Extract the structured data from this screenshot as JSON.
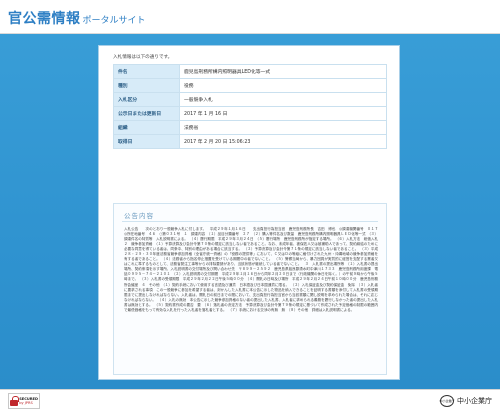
{
  "header": {
    "logo_main": "官公需情報",
    "logo_sub": "ポータルサイト"
  },
  "notice": "入札情報は以下の通りです。",
  "info_rows": [
    {
      "label": "件名",
      "value": "鹿児島刑務所構内照明器具LED化等一式"
    },
    {
      "label": "種別",
      "value": "役務"
    },
    {
      "label": "入札区分",
      "value": "一般競争入札"
    },
    {
      "label": "公示日または更新日",
      "value": "2017 年 1 月 16 日"
    },
    {
      "label": "組織",
      "value": "法務省"
    },
    {
      "label": "取得日",
      "value": "2017 年 2 月 20 日 15:06:23"
    }
  ],
  "content": {
    "title": "公告内容",
    "body": "入札公告　　次のとおり一般競争入札に付します。　平成２９年１月１６日　　支出負担行為担当官　鹿児島刑務所長　吉田　博也　◎調達機関番号　０１７　◎所在地番号　４６　○第０３１号　１　調達内容　（１）品目分類番号　２７　（２）購入等件名及び数量　鹿児島刑務所構内照明器具ＬＥＤ化等一式　（３）調達件名の特質等　入札説明書による。　（４）履行期限　平成２９年３月２４日　（５）履行場所　鹿児島刑務所が指定する場所。　（６）入札方法　総価入札　２　競争参加資格　（１）予算決算及び会計令第７０条の規定に該当しない者であること。なお、未成年者、被保佐人又は被補助人であって、契約締結のために必要な同意を得ている者は、同条中、特別の理由がある場合に該当する。　（２）予算決算及び会計令第７１条の規定に該当しない者であること。　（３）平成２８・２９・３０年度法務省競争参加資格（全省庁統一資格）の「役務の提供等」において、Ｃ又はＤの等級に格付けされた九州・沖縄地域の競争参加資格を有する者であること。　（４）法務省から指名停止措置を受けている期間中の者でないこと。　（５）警察当局から、暴力団員が実質的に経営を支配する業者又はこれに準ずるものとして、法務省発注工事等からの排除要請があり、当該状態が継続している者でないこと。　３　入札書の提出場所等　（１）入札書の提出場所、契約条項を示す場所、入札説明書の交付場所及び問い合わせ先　〒８９９－２５９２　鹿児島県姶良郡湧水町中津川１７３３　鹿児島刑務所用度課　電話０９９５－７４－２１０１　（２）入札説明書の交付期間　平成２９年１月１６日から同年２月２０日まで（行政機関の休日を除く。）の午前９時から午後５時まで。　（３）入札書の受領期限　平成２９年２月２２日午後５時００分　（４）開札の日時及び場所　平成２９年２月２４日午前１０時００分　鹿児島刑務所会議室　４　その他　（１）契約手続において使用する言語及び通貨　日本語及び日本国通貨に限る。　（２）入札保証金及び契約保証金　免除　（３）入札者に要求される事項　この一般競争に参加を希望する者は、封かんした入札書に本公告に示した物品を納入できることを証明する書類を添付して入札書の受領期限までに提出しなければならない。入札者は、開札日の前日までの間において、支出負担行為担当官から当該書類に関し説明を求められた場合は、それに応じなければならない。　（４）入札の無効　本公告に示した競争参加資格のない者の提出した入札書、入札者に求められる義務を履行しなかった者の提出した入札書は無効とする。　（５）契約書作成の要否　要　（６）落札者の決定方法　予算決算及び会計令第７９条の規定に基づいて作成された予定価格の制限の範囲内で最低価格をもって有効な入札を行った入札者を落札者とする。　（７）手続における交渉の有無　無　（８）その他　詳細は入札説明書による。"
  },
  "footer": {
    "ssl_line1": "SECURED",
    "ssl_line2": "by JPRS",
    "agency_mark": "中小企業庁",
    "agency_name": "中小企業庁"
  }
}
